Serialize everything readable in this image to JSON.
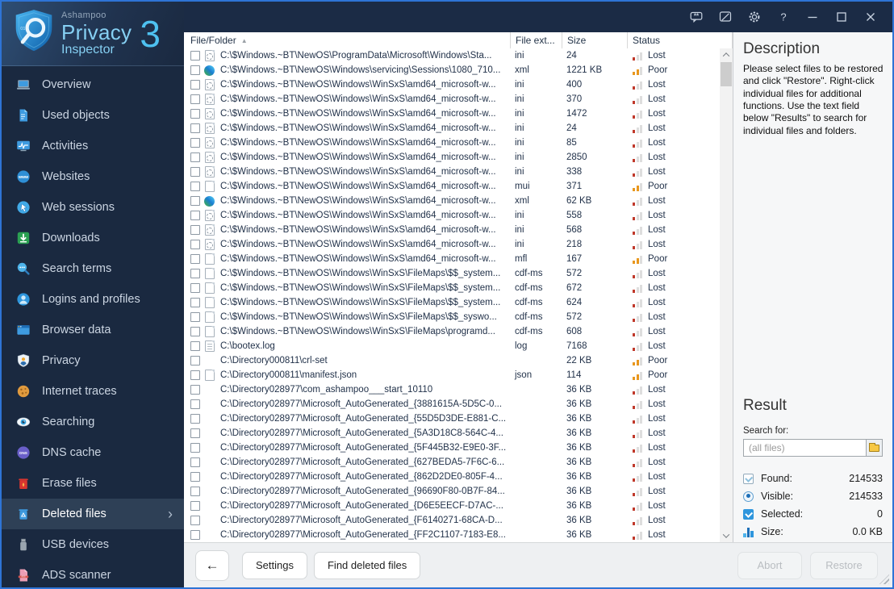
{
  "logo": {
    "brand": "Ashampoo",
    "product_line1": "Privacy",
    "product_line2": "Inspector",
    "version": "3"
  },
  "titlebar": {
    "icons": [
      {
        "name": "feedback-icon"
      },
      {
        "name": "edit-note-icon"
      },
      {
        "name": "settings-gear-icon"
      },
      {
        "name": "help-icon"
      },
      {
        "name": "minimize-icon"
      },
      {
        "name": "maximize-icon"
      },
      {
        "name": "close-icon"
      }
    ]
  },
  "sidebar": {
    "items": [
      {
        "label": "Overview",
        "icon": "overview",
        "selected": false
      },
      {
        "label": "Used objects",
        "icon": "used-objects",
        "selected": false
      },
      {
        "label": "Activities",
        "icon": "activities",
        "selected": false
      },
      {
        "label": "Websites",
        "icon": "websites",
        "selected": false
      },
      {
        "label": "Web sessions",
        "icon": "web-sessions",
        "selected": false
      },
      {
        "label": "Downloads",
        "icon": "downloads",
        "selected": false
      },
      {
        "label": "Search terms",
        "icon": "search-terms",
        "selected": false
      },
      {
        "label": "Logins and profiles",
        "icon": "logins-and-profiles",
        "selected": false
      },
      {
        "label": "Browser data",
        "icon": "browser-data",
        "selected": false
      },
      {
        "label": "Privacy",
        "icon": "privacy",
        "selected": false
      },
      {
        "label": "Internet traces",
        "icon": "internet-traces",
        "selected": false
      },
      {
        "label": "Searching",
        "icon": "searching",
        "selected": false
      },
      {
        "label": "DNS cache",
        "icon": "dns-cache",
        "selected": false
      },
      {
        "label": "Erase files",
        "icon": "erase-files",
        "selected": false
      },
      {
        "label": "Deleted files",
        "icon": "deleted-files",
        "selected": true
      },
      {
        "label": "USB devices",
        "icon": "usb-devices",
        "selected": false
      },
      {
        "label": "ADS scanner",
        "icon": "ads-scanner",
        "selected": false
      }
    ]
  },
  "table": {
    "columns": [
      {
        "label": "File/Folder",
        "sorted": "asc"
      },
      {
        "label": "File ext..."
      },
      {
        "label": "Size"
      },
      {
        "label": "Status"
      }
    ],
    "rows": [
      {
        "path": "C:\\$Windows.~BT\\NewOS\\ProgramData\\Microsoft\\Windows\\Sta...",
        "icon": "ini",
        "ext": "ini",
        "size": "24",
        "status": "Lost"
      },
      {
        "path": "C:\\$Windows.~BT\\NewOS\\Windows\\servicing\\Sessions\\1080_710...",
        "icon": "edge",
        "ext": "xml",
        "size": "1221 KB",
        "status": "Poor"
      },
      {
        "path": "C:\\$Windows.~BT\\NewOS\\Windows\\WinSxS\\amd64_microsoft-w...",
        "icon": "ini",
        "ext": "ini",
        "size": "400",
        "status": "Lost"
      },
      {
        "path": "C:\\$Windows.~BT\\NewOS\\Windows\\WinSxS\\amd64_microsoft-w...",
        "icon": "ini",
        "ext": "ini",
        "size": "370",
        "status": "Lost"
      },
      {
        "path": "C:\\$Windows.~BT\\NewOS\\Windows\\WinSxS\\amd64_microsoft-w...",
        "icon": "ini",
        "ext": "ini",
        "size": "1472",
        "status": "Lost"
      },
      {
        "path": "C:\\$Windows.~BT\\NewOS\\Windows\\WinSxS\\amd64_microsoft-w...",
        "icon": "ini",
        "ext": "ini",
        "size": "24",
        "status": "Lost"
      },
      {
        "path": "C:\\$Windows.~BT\\NewOS\\Windows\\WinSxS\\amd64_microsoft-w...",
        "icon": "ini",
        "ext": "ini",
        "size": "85",
        "status": "Lost"
      },
      {
        "path": "C:\\$Windows.~BT\\NewOS\\Windows\\WinSxS\\amd64_microsoft-w...",
        "icon": "ini",
        "ext": "ini",
        "size": "2850",
        "status": "Lost"
      },
      {
        "path": "C:\\$Windows.~BT\\NewOS\\Windows\\WinSxS\\amd64_microsoft-w...",
        "icon": "ini",
        "ext": "ini",
        "size": "338",
        "status": "Lost"
      },
      {
        "path": "C:\\$Windows.~BT\\NewOS\\Windows\\WinSxS\\amd64_microsoft-w...",
        "icon": "doc",
        "ext": "mui",
        "size": "371",
        "status": "Poor"
      },
      {
        "path": "C:\\$Windows.~BT\\NewOS\\Windows\\WinSxS\\amd64_microsoft-w...",
        "icon": "edge",
        "ext": "xml",
        "size": "62 KB",
        "status": "Lost"
      },
      {
        "path": "C:\\$Windows.~BT\\NewOS\\Windows\\WinSxS\\amd64_microsoft-w...",
        "icon": "ini",
        "ext": "ini",
        "size": "558",
        "status": "Lost"
      },
      {
        "path": "C:\\$Windows.~BT\\NewOS\\Windows\\WinSxS\\amd64_microsoft-w...",
        "icon": "ini",
        "ext": "ini",
        "size": "568",
        "status": "Lost"
      },
      {
        "path": "C:\\$Windows.~BT\\NewOS\\Windows\\WinSxS\\amd64_microsoft-w...",
        "icon": "ini",
        "ext": "ini",
        "size": "218",
        "status": "Lost"
      },
      {
        "path": "C:\\$Windows.~BT\\NewOS\\Windows\\WinSxS\\amd64_microsoft-w...",
        "icon": "doc",
        "ext": "mfl",
        "size": "167",
        "status": "Poor"
      },
      {
        "path": "C:\\$Windows.~BT\\NewOS\\Windows\\WinSxS\\FileMaps\\$$_system...",
        "icon": "doc",
        "ext": "cdf-ms",
        "size": "572",
        "status": "Lost"
      },
      {
        "path": "C:\\$Windows.~BT\\NewOS\\Windows\\WinSxS\\FileMaps\\$$_system...",
        "icon": "doc",
        "ext": "cdf-ms",
        "size": "672",
        "status": "Lost"
      },
      {
        "path": "C:\\$Windows.~BT\\NewOS\\Windows\\WinSxS\\FileMaps\\$$_system...",
        "icon": "doc",
        "ext": "cdf-ms",
        "size": "624",
        "status": "Lost"
      },
      {
        "path": "C:\\$Windows.~BT\\NewOS\\Windows\\WinSxS\\FileMaps\\$$_syswo...",
        "icon": "doc",
        "ext": "cdf-ms",
        "size": "572",
        "status": "Lost"
      },
      {
        "path": "C:\\$Windows.~BT\\NewOS\\Windows\\WinSxS\\FileMaps\\programd...",
        "icon": "doc",
        "ext": "cdf-ms",
        "size": "608",
        "status": "Lost"
      },
      {
        "path": "C:\\bootex.log",
        "icon": "log",
        "ext": "log",
        "size": "7168",
        "status": "Lost"
      },
      {
        "path": "C:\\Directory000811\\crl-set",
        "icon": "none",
        "ext": "",
        "size": "22 KB",
        "status": "Poor"
      },
      {
        "path": "C:\\Directory000811\\manifest.json",
        "icon": "doc",
        "ext": "json",
        "size": "114",
        "status": "Poor"
      },
      {
        "path": "C:\\Directory028977\\com_ashampoo___start_10110",
        "icon": "none",
        "ext": "",
        "size": "36 KB",
        "status": "Lost"
      },
      {
        "path": "C:\\Directory028977\\Microsoft_AutoGenerated_{3881615A-5D5C-0...",
        "icon": "none",
        "ext": "",
        "size": "36 KB",
        "status": "Lost"
      },
      {
        "path": "C:\\Directory028977\\Microsoft_AutoGenerated_{55D5D3DE-E881-C...",
        "icon": "none",
        "ext": "",
        "size": "36 KB",
        "status": "Lost"
      },
      {
        "path": "C:\\Directory028977\\Microsoft_AutoGenerated_{5A3D18C8-564C-4...",
        "icon": "none",
        "ext": "",
        "size": "36 KB",
        "status": "Lost"
      },
      {
        "path": "C:\\Directory028977\\Microsoft_AutoGenerated_{5F445B32-E9E0-3F...",
        "icon": "none",
        "ext": "",
        "size": "36 KB",
        "status": "Lost"
      },
      {
        "path": "C:\\Directory028977\\Microsoft_AutoGenerated_{627BEDA5-7F6C-6...",
        "icon": "none",
        "ext": "",
        "size": "36 KB",
        "status": "Lost"
      },
      {
        "path": "C:\\Directory028977\\Microsoft_AutoGenerated_{862D2DE0-805F-4...",
        "icon": "none",
        "ext": "",
        "size": "36 KB",
        "status": "Lost"
      },
      {
        "path": "C:\\Directory028977\\Microsoft_AutoGenerated_{96690F80-0B7F-84...",
        "icon": "none",
        "ext": "",
        "size": "36 KB",
        "status": "Lost"
      },
      {
        "path": "C:\\Directory028977\\Microsoft_AutoGenerated_{D6E5EECF-D7AC-...",
        "icon": "none",
        "ext": "",
        "size": "36 KB",
        "status": "Lost"
      },
      {
        "path": "C:\\Directory028977\\Microsoft_AutoGenerated_{F6140271-68CA-D...",
        "icon": "none",
        "ext": "",
        "size": "36 KB",
        "status": "Lost"
      },
      {
        "path": "C:\\Directory028977\\Microsoft_AutoGenerated_{FF2C1107-7183-E8...",
        "icon": "none",
        "ext": "",
        "size": "36 KB",
        "status": "Lost"
      }
    ]
  },
  "description": {
    "title": "Description",
    "body": "Please select files to be restored and click \"Restore\". Right-click individual files for additional functions. Use the text field below \"Results\" to search for individual files and folders."
  },
  "result": {
    "title": "Result",
    "search_label": "Search for:",
    "search_placeholder": "(all files)",
    "stats": [
      {
        "icon": "found",
        "label": "Found:",
        "value": "214533"
      },
      {
        "icon": "visible",
        "label": "Visible:",
        "value": "214533"
      },
      {
        "icon": "selected",
        "label": "Selected:",
        "value": "0"
      },
      {
        "icon": "size",
        "label": "Size:",
        "value": "0.0 KB"
      }
    ]
  },
  "footer": {
    "back_glyph": "←",
    "settings_label": "Settings",
    "find_label": "Find deleted files",
    "abort_label": "Abort",
    "restore_label": "Restore"
  },
  "colors": {
    "accent_blue": "#4ec1f0",
    "status_lost": "#c0392b",
    "status_poor": "#e8971e",
    "sidebar_bg": "#1a2940",
    "selected_item_bg": "#2e4056"
  }
}
